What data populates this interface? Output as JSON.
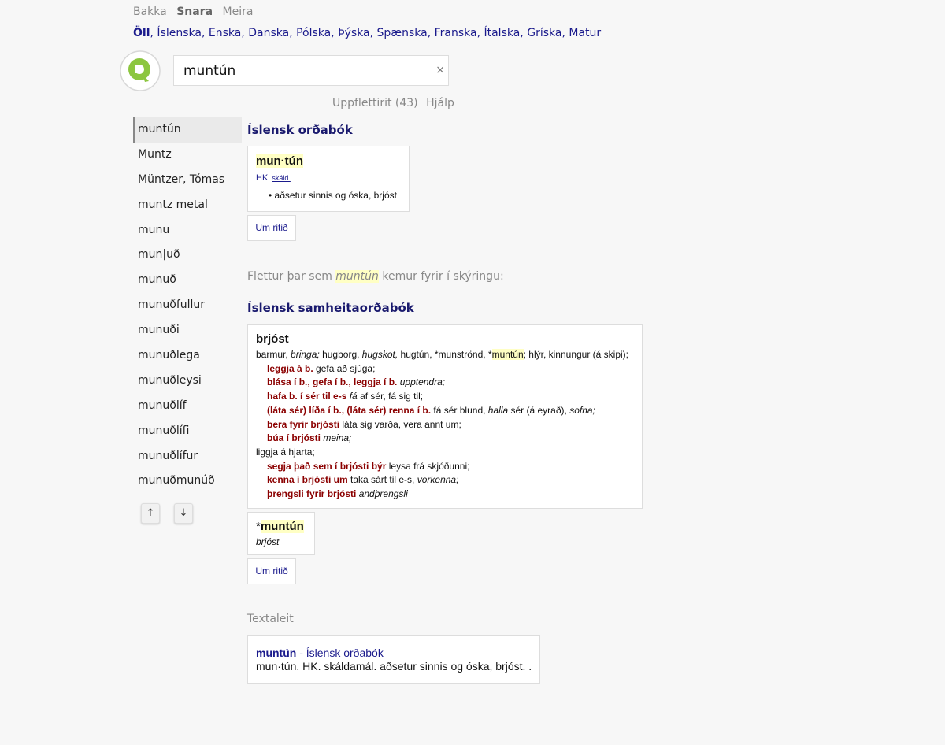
{
  "topnav": {
    "back": "Bakka",
    "snara": "Snara",
    "meira": "Meira"
  },
  "languages": [
    "Öll",
    "Íslenska",
    "Enska",
    "Danska",
    "Pólska",
    "Þýska",
    "Spænska",
    "Franska",
    "Ítalska",
    "Gríska",
    "Matur"
  ],
  "search": {
    "value": "muntún",
    "clear": "×"
  },
  "sublinks": {
    "uppflettirit": "Uppflettirit (43)",
    "hjalp": "Hjálp"
  },
  "sidebar": {
    "items": [
      "muntún",
      "Muntz",
      "Müntzer, Tómas",
      "muntz metal",
      "munu",
      "mun|uð",
      "munuð",
      "munuðfullur",
      "munuði",
      "munuðlega",
      "munuðleysi",
      "munuðlíf",
      "munuðlífi",
      "munuðlífur",
      "munuðmunúð"
    ],
    "up": "↑",
    "down": "↓"
  },
  "section1": {
    "title": "Íslensk orðabók",
    "headword": "mun·tún",
    "gram": "HK",
    "usage": "skáld.",
    "definition": "aðsetur sinnis og óska, brjóst",
    "about": "Um ritið"
  },
  "flettur": {
    "pre": "Flettur þar sem",
    "word": "muntún",
    "post": "kemur fyrir í skýringu:"
  },
  "section2": {
    "title": "Íslensk samheitaorðabók",
    "headword": "brjóst",
    "syn": {
      "a": "barmur,",
      "b": "bringa;",
      "c": "hugborg,",
      "d": "hugskot,",
      "e": "hugtún, *munströnd, *",
      "f": "muntún",
      "g": "; hlýr, kinnungur (á skipi);"
    },
    "lines": {
      "l1p": "leggja á b.",
      "l1t": "gefa að sjúga;",
      "l2p": "blása í b., gefa í b., leggja í b.",
      "l2i": "upptendra;",
      "l3p": "hafa b. í sér til e-s",
      "l3i": "fá",
      "l3t": "af sér, fá sig til;",
      "l4p": "(láta sér) líða í b., (láta sér) renna í b.",
      "l4t": "fá sér blund,",
      "l4i": "halla",
      "l4t2": "sér (á eyrað),",
      "l4i2": "sofna;",
      "l5p": "bera fyrir brjósti",
      "l5t": "láta sig varða, vera annt um;",
      "l6p": "búa í brjósti",
      "l6i": "meina;",
      "l7": "liggja á hjarta;",
      "l8p": "segja það sem í brjósti býr",
      "l8t": "leysa frá skjóðunni;",
      "l9p": "kenna í brjósti um",
      "l9t": "taka sárt til e-s,",
      "l9i": "vorkenna;",
      "l10p": "þrengsli fyrir brjósti",
      "l10i": "andþrengsli"
    },
    "entry2": {
      "star": "*",
      "word": "muntún",
      "syn": "brjóst"
    },
    "about": "Um ritið"
  },
  "textaleit": {
    "label": "Textaleit",
    "word": "muntún",
    "source": "- Íslensk orðabók",
    "snippet": "mun·tún. HK. skáldamál. aðsetur sinnis og óska, brjóst. ."
  },
  "colors": {
    "accent": "#1a1a8c",
    "phrase": "#8b0000",
    "highlight": "#ffffc4",
    "logo": "#8cc63f"
  }
}
